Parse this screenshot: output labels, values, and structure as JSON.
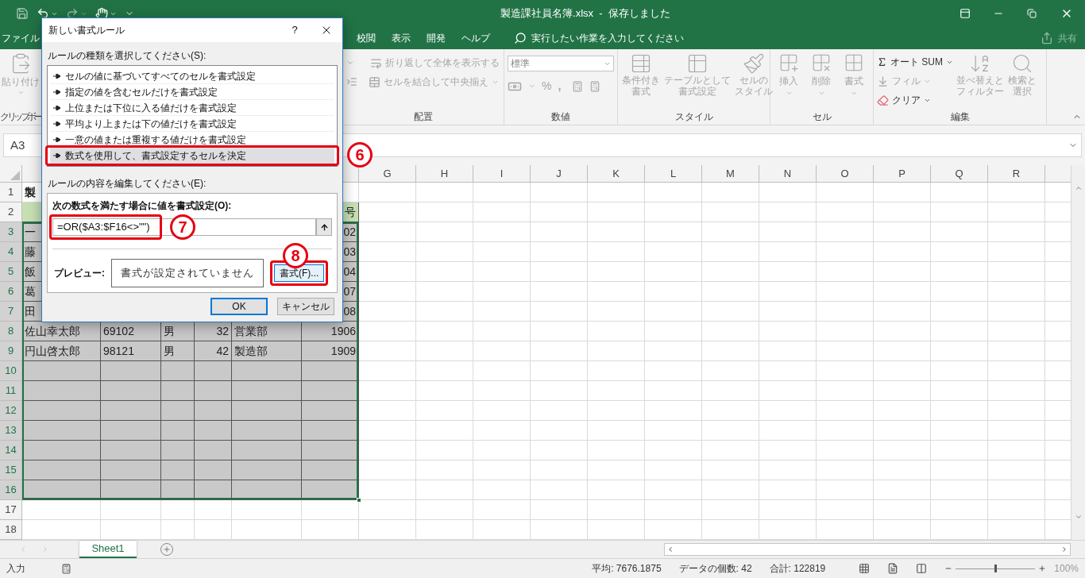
{
  "title_bar": {
    "title": "製造課社員名簿.xlsx  -  保存しました"
  },
  "menu": {
    "tabs": [
      {
        "label": "ファイル"
      },
      {
        "label": "校閲"
      },
      {
        "label": "表示"
      },
      {
        "label": "開発"
      },
      {
        "label": "ヘルプ"
      }
    ],
    "search": {
      "placeholder": "実行したい作業を入力してください"
    },
    "share": "共有"
  },
  "ribbon": {
    "clipboard": {
      "paste": {
        "label": "貼り付け",
        "disabled": true
      },
      "label": "クリップボー"
    },
    "alignment": {
      "wrap": {
        "label": "折り返して全体を表示する",
        "disabled": true
      },
      "merge": {
        "label": "セルを結合して中央揃え",
        "disabled": true
      },
      "label": "配置"
    },
    "number": {
      "format": "標準",
      "percent": "%",
      "comma": ",",
      "label": "数値"
    },
    "styles": {
      "buttons": [
        {
          "lines": [
            "条件付き",
            "書式"
          ],
          "disabled": true
        },
        {
          "lines": [
            "テーブルとして",
            "書式設定"
          ],
          "disabled": true
        },
        {
          "lines": [
            "セルの",
            "スタイル"
          ],
          "disabled": true
        }
      ],
      "label": "スタイル"
    },
    "cells": {
      "buttons": [
        {
          "lines": [
            "挿入"
          ],
          "disabled": true
        },
        {
          "lines": [
            "削除"
          ],
          "disabled": true
        },
        {
          "lines": [
            "書式"
          ],
          "disabled": true
        }
      ],
      "label": "セル"
    },
    "editing": {
      "small": [
        {
          "label": "オート SUM",
          "disabled": false
        },
        {
          "label": "フィル",
          "disabled": true
        },
        {
          "label": "クリア",
          "disabled": false
        }
      ],
      "large": [
        {
          "lines": [
            "並べ替えと",
            "フィルター"
          ],
          "disabled": true
        },
        {
          "lines": [
            "検索と",
            "選択"
          ],
          "disabled": true
        }
      ],
      "label": "編集"
    }
  },
  "formula_bar": {
    "name_box": "A3"
  },
  "sheet": {
    "column_headers": [
      "G",
      "H",
      "I",
      "J",
      "K",
      "L",
      "M",
      "N",
      "O",
      "P",
      "Q",
      "R"
    ],
    "rows": [
      {
        "header": "1",
        "kind": "title",
        "selected": false,
        "cells": {
          "A": "製"
        }
      },
      {
        "header": "2",
        "kind": "header",
        "selected": false,
        "cells": {
          "F": "号"
        }
      },
      {
        "header": "3",
        "kind": "data",
        "selected": true,
        "cells": {
          "A": "一",
          "F": "02"
        }
      },
      {
        "header": "4",
        "kind": "data",
        "selected": true,
        "cells": {
          "A": "藤",
          "F": "03"
        }
      },
      {
        "header": "5",
        "kind": "data",
        "selected": true,
        "cells": {
          "A": "飯",
          "F": "04"
        }
      },
      {
        "header": "6",
        "kind": "data",
        "selected": true,
        "cells": {
          "A": "葛",
          "F": "07"
        }
      },
      {
        "header": "7",
        "kind": "data",
        "selected": true,
        "cells": {
          "A": "田",
          "F": "08"
        }
      },
      {
        "header": "8",
        "kind": "data",
        "selected": true,
        "cells": {
          "A": "佐山幸太郎",
          "B": "69102",
          "C": "男",
          "D": "32",
          "E": "営業部",
          "F": "1906"
        }
      },
      {
        "header": "9",
        "kind": "data",
        "selected": true,
        "cells": {
          "A": "円山啓太郎",
          "B": "98121",
          "C": "男",
          "D": "42",
          "E": "製造部",
          "F": "1909"
        }
      },
      {
        "header": "10",
        "kind": "data",
        "selected": true
      },
      {
        "header": "11",
        "kind": "data",
        "selected": true
      },
      {
        "header": "12",
        "kind": "data",
        "selected": true
      },
      {
        "header": "13",
        "kind": "data",
        "selected": true
      },
      {
        "header": "14",
        "kind": "data",
        "selected": true
      },
      {
        "header": "15",
        "kind": "data",
        "selected": true
      },
      {
        "header": "16",
        "kind": "data",
        "selected": true
      },
      {
        "header": "17",
        "kind": "data",
        "selected": false
      },
      {
        "header": "18",
        "kind": "data",
        "selected": false
      }
    ]
  },
  "sheet_tabs": [
    {
      "label": "Sheet1",
      "selected": true
    }
  ],
  "status_bar": {
    "mode": "入力",
    "stats": [
      "平均: 7676.1875",
      "データの個数: 42",
      "合計: 122819"
    ],
    "zoom": {
      "level": 0.5,
      "reading": "100%"
    }
  },
  "dialog": {
    "title": "新しい書式ルール",
    "help": "?",
    "rule_type_label": "ルールの種類を選択してください(S):",
    "rule_types": [
      {
        "label": "セルの値に基づいてすべてのセルを書式設定",
        "selected": false
      },
      {
        "label": "指定の値を含むセルだけを書式設定",
        "selected": false
      },
      {
        "label": "上位または下位に入る値だけを書式設定",
        "selected": false
      },
      {
        "label": "平均より上または下の値だけを書式設定",
        "selected": false
      },
      {
        "label": "一意の値または重複する値だけを書式設定",
        "selected": false
      },
      {
        "label": "数式を使用して、書式設定するセルを決定",
        "selected": true
      }
    ],
    "edit_label": "ルールの内容を編集してください(E):",
    "formula_label": "次の数式を満たす場合に値を書式設定(O):",
    "formula": "=OR($A3:$F16<>\"\")",
    "preview_label": "プレビュー:",
    "preview_text": "書式が設定されていません",
    "format_button": "書式(F)...",
    "buttons": [
      {
        "label": "OK",
        "default": true
      },
      {
        "label": "キャンセル",
        "default": false
      }
    ]
  },
  "annotations": [
    {
      "number": "6"
    },
    {
      "number": "7"
    },
    {
      "number": "8"
    }
  ]
}
